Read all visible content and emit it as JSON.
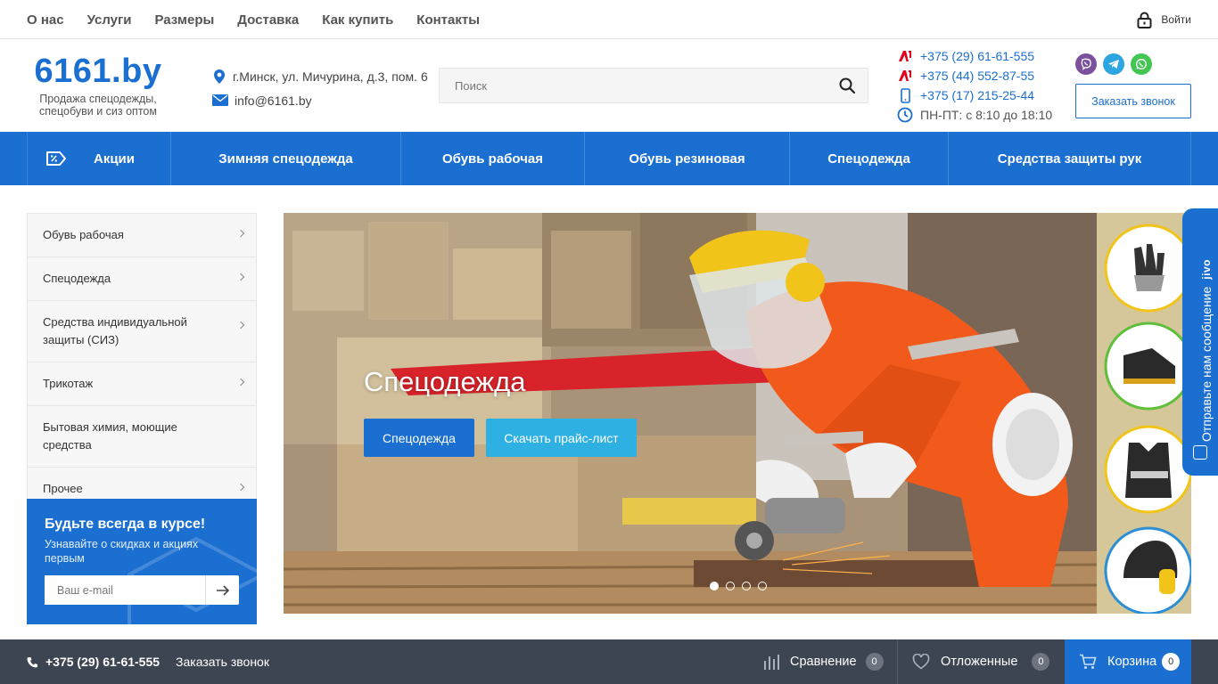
{
  "topnav": {
    "items": [
      "О нас",
      "Услуги",
      "Размеры",
      "Доставка",
      "Как купить",
      "Контакты"
    ],
    "login": "Войти"
  },
  "header": {
    "logo": "6161.by",
    "tagline": "Продажа спецодежды, спецобуви и сиз оптом",
    "address": "г.Минск, ул. Мичурина, д.3, пом. 6",
    "email": "info@6161.by",
    "search_placeholder": "Поиск",
    "phones": [
      "+375 (29) 61-61-555",
      "+375 (44) 552-87-55",
      "+375 (17) 215-25-44"
    ],
    "hours": "ПН-ПТ: с 8:10 до 18:10",
    "callback": "Заказать звонок"
  },
  "categories": [
    "Акции",
    "Зимняя спецодежда",
    "Обувь рабочая",
    "Обувь резиновая",
    "Спецодежда",
    "Средства защиты рук"
  ],
  "sidebar": {
    "items": [
      {
        "label": "Обувь рабочая",
        "arrow": true
      },
      {
        "label": "Спецодежда",
        "arrow": true
      },
      {
        "label": "Средства индивидуальной защиты (СИЗ)",
        "arrow": true
      },
      {
        "label": "Трикотаж",
        "arrow": true
      },
      {
        "label": "Бытовая химия, моющие средства",
        "arrow": false
      },
      {
        "label": "Прочее",
        "arrow": true
      }
    ]
  },
  "subscribe": {
    "title": "Будьте всегда в курсе!",
    "text": "Узнавайте о скидках и акциях первым",
    "placeholder": "Ваш e-mail"
  },
  "hero": {
    "title": "Спецодежда",
    "button1": "Спецодежда",
    "button2": "Скачать прайс-лист",
    "slides": 4,
    "active_slide": 1
  },
  "jivo": {
    "label": "Отправьте нам сообщение",
    "brand": "jivo"
  },
  "bottombar": {
    "phone": "+375 (29) 61-61-555",
    "callback": "Заказать звонок",
    "compare_label": "Сравнение",
    "compare_count": "0",
    "fav_label": "Отложенные",
    "fav_count": "0",
    "cart_label": "Корзина",
    "cart_count": "0"
  },
  "colors": {
    "brand_blue": "#1a6fd1",
    "light_blue": "#2fb0e3",
    "bottom_bar": "#3e4552",
    "viber": "#7b519d",
    "telegram": "#2ca5e0",
    "whatsapp": "#43c553",
    "a1_red": "#e2001a"
  }
}
